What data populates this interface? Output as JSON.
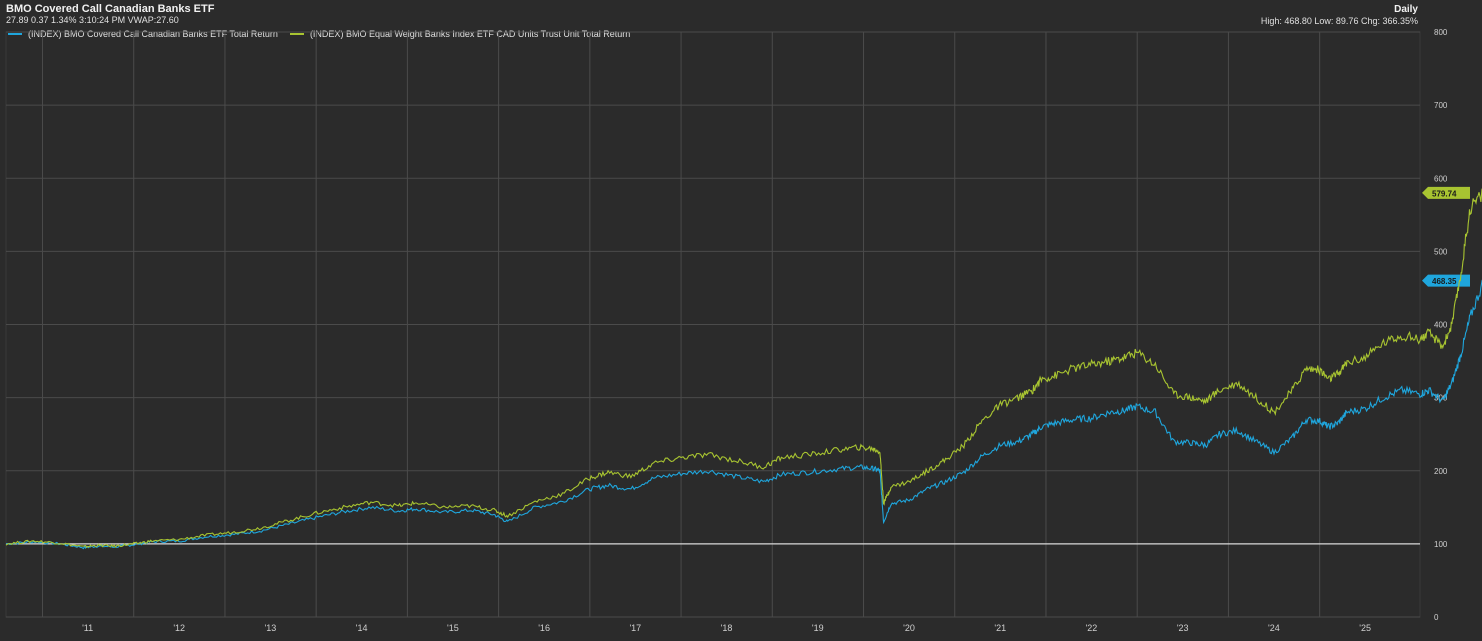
{
  "header": {
    "title": "BMO Covered Call Canadian Banks ETF",
    "quote": "27.89 0.37 1.34% 3:10:24 PM VWAP:27.60",
    "frequency": "Daily",
    "stats": "High: 468.80 Low: 89.76 Chg: 366.35%"
  },
  "colors": {
    "background": "#2b2b2b",
    "grid": "#4b4b4b",
    "series_blue": "#1fa6dd",
    "series_green": "#a8c431",
    "baseline": "#d9d9d9"
  },
  "chart_data": {
    "type": "line",
    "title": "BMO Covered Call Canadian Banks ETF",
    "xlabel": "",
    "ylabel": "",
    "x_ticks": [
      "'11",
      "'12",
      "'13",
      "'14",
      "'15",
      "'16",
      "'17",
      "'18",
      "'19",
      "'20",
      "'21",
      "'22",
      "'23",
      "'24",
      "'25"
    ],
    "y_ticks": [
      "0",
      "100",
      "200",
      "300",
      "400",
      "500",
      "600",
      "700",
      "800"
    ],
    "ylim": [
      0,
      800
    ],
    "xlim": [
      2010.6,
      2026.1
    ],
    "reference_line": 100,
    "grid": true,
    "legend_position": "top-left",
    "series": [
      {
        "name": "(INDEX) BMO Covered Call Canadian Banks ETF  Total Return",
        "color": "#1fa6dd",
        "last_label": "468.35",
        "x": [
          2010.6,
          2010.9,
          2011.2,
          2011.45,
          2011.6,
          2011.8,
          2012.0,
          2012.2,
          2012.5,
          2012.8,
          2013.1,
          2013.4,
          2013.7,
          2014.0,
          2014.3,
          2014.6,
          2014.9,
          2015.1,
          2015.4,
          2015.7,
          2015.95,
          2016.1,
          2016.4,
          2016.7,
          2017.0,
          2017.2,
          2017.45,
          2017.7,
          2018.0,
          2018.3,
          2018.6,
          2018.9,
          2019.1,
          2019.4,
          2019.7,
          2019.95,
          2020.1,
          2020.18,
          2020.22,
          2020.3,
          2020.5,
          2020.7,
          2020.9,
          2021.1,
          2021.3,
          2021.5,
          2021.7,
          2021.85,
          2021.95,
          2022.1,
          2022.3,
          2022.5,
          2022.7,
          2022.85,
          2023.0,
          2023.2,
          2023.4,
          2023.6,
          2023.75,
          2023.9,
          2024.1,
          2024.3,
          2024.5,
          2024.7,
          2024.85,
          2025.0,
          2025.1,
          2025.2,
          2025.3,
          2025.5,
          2025.7,
          2025.9,
          2026.1,
          2026.2,
          2026.35,
          2026.45,
          2026.55,
          2026.65,
          2026.8
        ],
        "y": [
          100,
          103,
          100,
          95,
          97,
          96,
          99,
          103,
          104,
          110,
          113,
          118,
          127,
          136,
          144,
          150,
          145,
          148,
          143,
          146,
          140,
          130,
          150,
          158,
          175,
          180,
          175,
          190,
          196,
          200,
          192,
          185,
          195,
          198,
          202,
          205,
          203,
          200,
          130,
          155,
          160,
          175,
          185,
          198,
          220,
          235,
          240,
          250,
          260,
          265,
          270,
          272,
          280,
          282,
          288,
          280,
          240,
          238,
          235,
          250,
          255,
          240,
          225,
          245,
          270,
          268,
          260,
          265,
          280,
          285,
          300,
          310,
          305,
          310,
          295,
          320,
          360,
          410,
          460
        ]
      },
      {
        "name": "(INDEX) BMO Equal Weight Banks Index ETF CAD Units Trust Unit  Total Return",
        "color": "#a8c431",
        "last_label": "579.74",
        "x": [
          2010.6,
          2010.9,
          2011.2,
          2011.45,
          2011.6,
          2011.8,
          2012.0,
          2012.2,
          2012.5,
          2012.8,
          2013.1,
          2013.4,
          2013.7,
          2014.0,
          2014.3,
          2014.6,
          2014.9,
          2015.1,
          2015.4,
          2015.7,
          2015.95,
          2016.1,
          2016.4,
          2016.7,
          2017.0,
          2017.2,
          2017.45,
          2017.7,
          2018.0,
          2018.3,
          2018.6,
          2018.9,
          2019.1,
          2019.4,
          2019.7,
          2019.95,
          2020.1,
          2020.18,
          2020.22,
          2020.3,
          2020.5,
          2020.7,
          2020.9,
          2021.1,
          2021.3,
          2021.5,
          2021.7,
          2021.85,
          2021.95,
          2022.1,
          2022.3,
          2022.5,
          2022.7,
          2022.85,
          2023.0,
          2023.2,
          2023.4,
          2023.6,
          2023.75,
          2023.9,
          2024.1,
          2024.3,
          2024.5,
          2024.7,
          2024.85,
          2025.0,
          2025.1,
          2025.2,
          2025.3,
          2025.5,
          2025.7,
          2025.9,
          2026.1,
          2026.2,
          2026.35,
          2026.45,
          2026.55,
          2026.65,
          2026.8
        ],
        "y": [
          100,
          104,
          101,
          96,
          98,
          97,
          100,
          104,
          106,
          112,
          116,
          122,
          132,
          142,
          150,
          157,
          152,
          156,
          150,
          152,
          146,
          138,
          158,
          168,
          190,
          198,
          192,
          210,
          218,
          222,
          214,
          205,
          218,
          222,
          228,
          232,
          230,
          226,
          155,
          178,
          185,
          200,
          215,
          235,
          268,
          290,
          300,
          310,
          325,
          330,
          340,
          345,
          350,
          355,
          362,
          345,
          305,
          300,
          295,
          310,
          320,
          300,
          280,
          310,
          340,
          338,
          325,
          332,
          348,
          355,
          375,
          385,
          380,
          388,
          370,
          400,
          470,
          560,
          580
        ]
      }
    ]
  }
}
